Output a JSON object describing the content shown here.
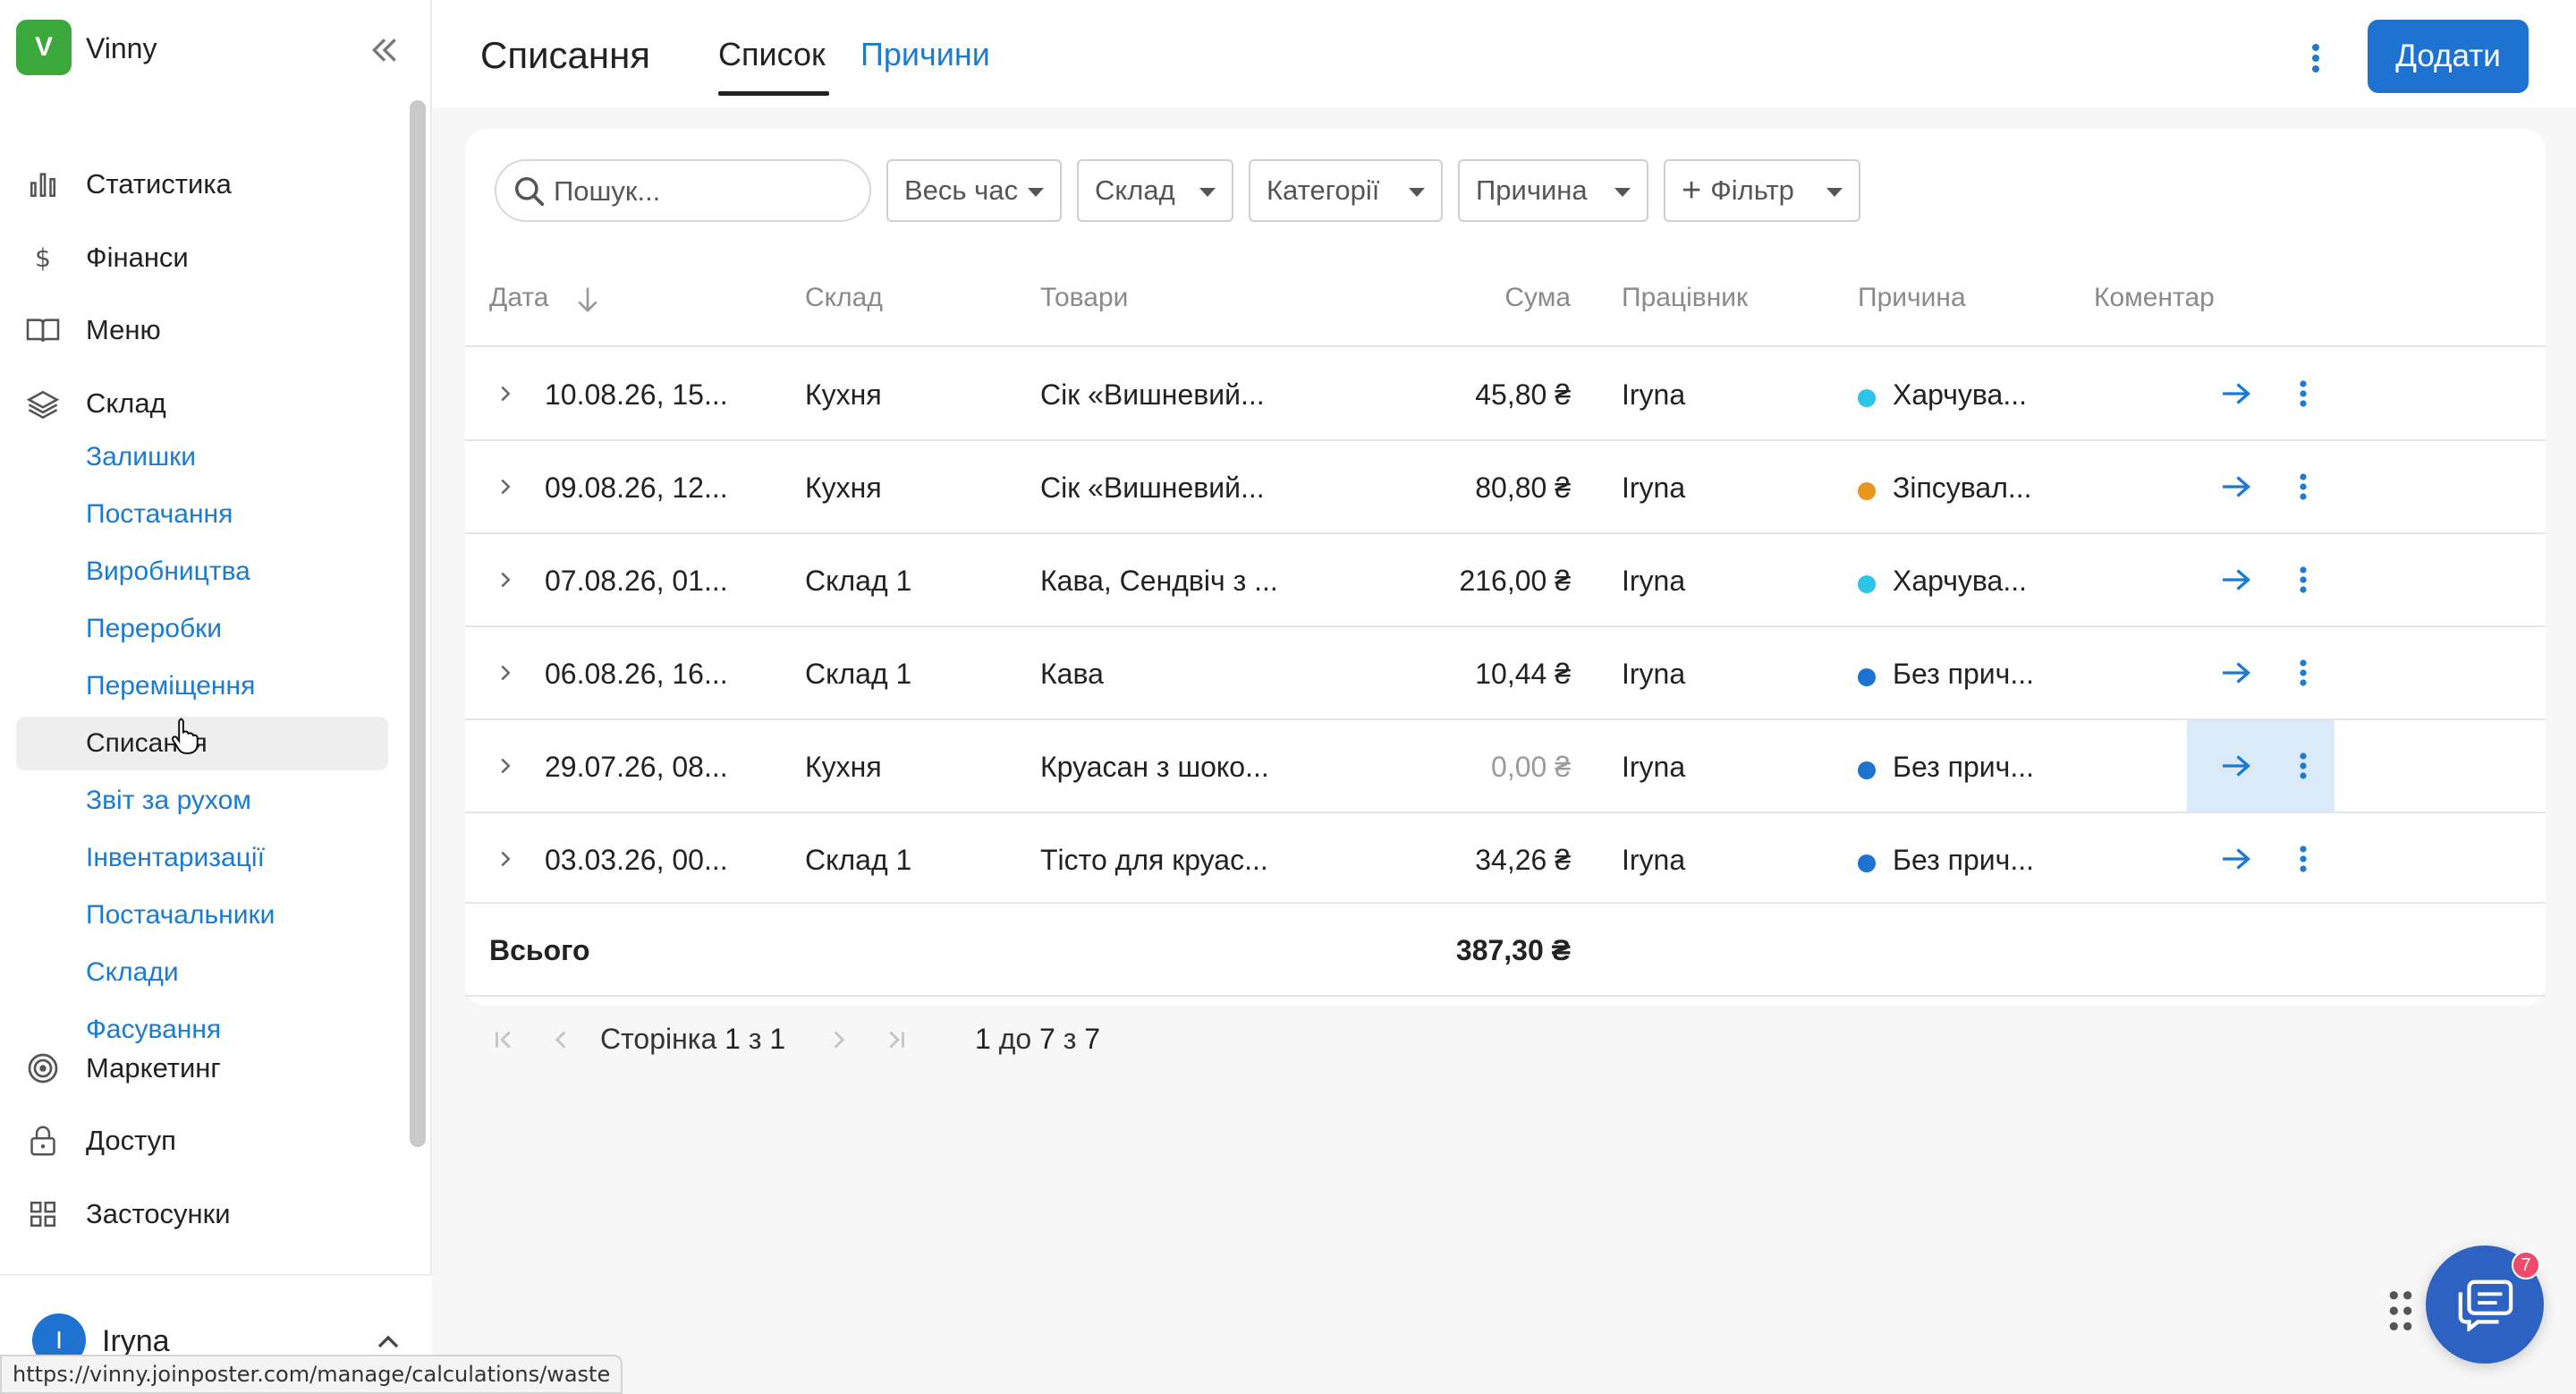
{
  "app": {
    "name": "Vinny",
    "logo_letter": "V"
  },
  "sidebar": {
    "main_items": [
      {
        "label": "Статистика",
        "icon": "bar-chart-icon"
      },
      {
        "label": "Фінанси",
        "icon": "dollar-icon"
      },
      {
        "label": "Меню",
        "icon": "book-icon"
      },
      {
        "label": "Склад",
        "icon": "layers-icon"
      },
      {
        "label": "Маркетинг",
        "icon": "target-icon"
      },
      {
        "label": "Доступ",
        "icon": "lock-icon"
      },
      {
        "label": "Застосунки",
        "icon": "grid-icon"
      }
    ],
    "sub_items": [
      {
        "label": "Залишки"
      },
      {
        "label": "Постачання"
      },
      {
        "label": "Виробництва"
      },
      {
        "label": "Переробки"
      },
      {
        "label": "Переміщення"
      },
      {
        "label": "Списання",
        "active": true
      },
      {
        "label": "Звіт за рухом"
      },
      {
        "label": "Інвентаризації"
      },
      {
        "label": "Постачальники"
      },
      {
        "label": "Склади"
      },
      {
        "label": "Фасування"
      }
    ],
    "user": {
      "initial": "I",
      "name": "Iryna"
    }
  },
  "status_bar_url": "https://vinny.joinposter.com/manage/calculations/waste",
  "header": {
    "title": "Списання",
    "tabs": [
      {
        "label": "Список",
        "active": true
      },
      {
        "label": "Причини",
        "active": false
      }
    ],
    "add_button": "Додати"
  },
  "filters": {
    "search_placeholder": "Пошук...",
    "period": "Весь час",
    "warehouse": "Склад",
    "categories": "Категорії",
    "reason": "Причина",
    "add_filter": "Фільтр"
  },
  "table": {
    "columns": [
      "Дата",
      "Склад",
      "Товари",
      "Сума",
      "Працівник",
      "Причина",
      "Коментар"
    ],
    "rows": [
      {
        "date": "10.08.26, 15...",
        "warehouse": "Кухня",
        "products": "Сік «Вишневий...",
        "sum": "45,80 ₴",
        "employee": "Iryna",
        "reason": "Харчува...",
        "reason_color": "#2cc4e8",
        "comment": ""
      },
      {
        "date": "09.08.26, 12...",
        "warehouse": "Кухня",
        "products": "Сік «Вишневий...",
        "sum": "80,80 ₴",
        "employee": "Iryna",
        "reason": "Зіпсувал...",
        "reason_color": "#e8961e",
        "comment": ""
      },
      {
        "date": "07.08.26, 01...",
        "warehouse": "Склад 1",
        "products": "Кава, Сендвіч з ...",
        "sum": "216,00 ₴",
        "employee": "Iryna",
        "reason": "Харчува...",
        "reason_color": "#2cc4e8",
        "comment": ""
      },
      {
        "date": "06.08.26, 16...",
        "warehouse": "Склад 1",
        "products": "Кава",
        "sum": "10,44 ₴",
        "employee": "Iryna",
        "reason": "Без прич...",
        "reason_color": "#1e73d1",
        "comment": ""
      },
      {
        "date": "29.07.26, 08...",
        "warehouse": "Кухня",
        "products": "Круасан з шоко...",
        "sum": "0,00 ₴",
        "employee": "Iryna",
        "reason": "Без прич...",
        "reason_color": "#1e73d1",
        "comment": ""
      },
      {
        "date": "03.03.26, 00...",
        "warehouse": "Склад 1",
        "products": "Тісто для круас...",
        "sum": "34,26 ₴",
        "employee": "Iryna",
        "reason": "Без прич...",
        "reason_color": "#1e73d1",
        "comment": ""
      }
    ],
    "total_label": "Всього",
    "total_value": "387,30 ₴"
  },
  "pagination": {
    "page_word": "Сторінка",
    "page": "1",
    "of_word": "з",
    "pages": "1",
    "range_from": "1",
    "to_word": "до",
    "range_to": "7",
    "of_word2": "з",
    "total": "7"
  },
  "chat": {
    "badge": "7"
  }
}
